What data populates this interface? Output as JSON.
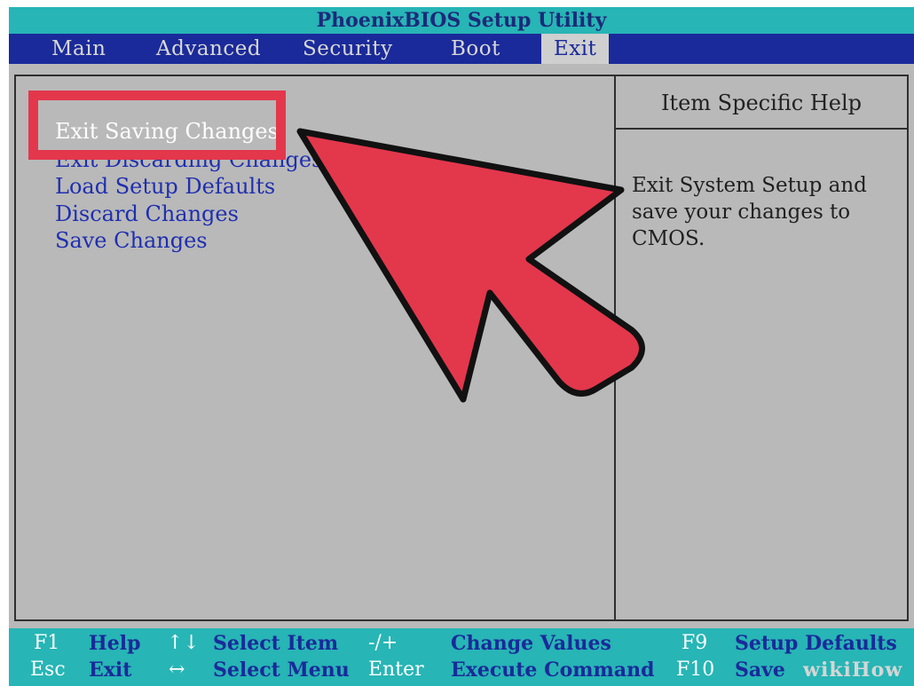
{
  "title": "PhoenixBIOS Setup Utility",
  "tabs": [
    {
      "label": "Main"
    },
    {
      "label": "Advanced"
    },
    {
      "label": "Security"
    },
    {
      "label": "Boot"
    },
    {
      "label": "Exit",
      "selected": true
    }
  ],
  "exit_menu": {
    "items": [
      {
        "label": "Exit Saving Changes",
        "selected": true
      },
      {
        "label": "Exit Discarding Changes"
      },
      {
        "label": "Load Setup Defaults"
      },
      {
        "label": "Discard Changes"
      },
      {
        "label": "Save Changes"
      }
    ]
  },
  "help": {
    "title": "Item Specific Help",
    "lines": [
      "Exit System Setup and",
      "save your changes to",
      "CMOS."
    ]
  },
  "footer": {
    "row1": [
      {
        "key": "F1",
        "desc": "Help"
      },
      {
        "key": "↑↓",
        "desc": "Select Item"
      },
      {
        "key": "-/+",
        "desc": "Change Values"
      },
      {
        "key": "F9",
        "desc": "Setup Defaults"
      }
    ],
    "row2": [
      {
        "key": "Esc",
        "desc": "Exit"
      },
      {
        "key": "↔",
        "desc": "Select Menu"
      },
      {
        "key": "Enter",
        "desc": "Execute Command"
      },
      {
        "key": "F10",
        "desc": "Save"
      }
    ]
  },
  "watermark": "wikiHow",
  "colors": {
    "title_bg": "#27b5b5",
    "menu_bar_bg": "#1a2a9a",
    "panel_bg": "#b9b9b9",
    "item_text": "#1f2fb0",
    "highlight": "#e3374c"
  }
}
